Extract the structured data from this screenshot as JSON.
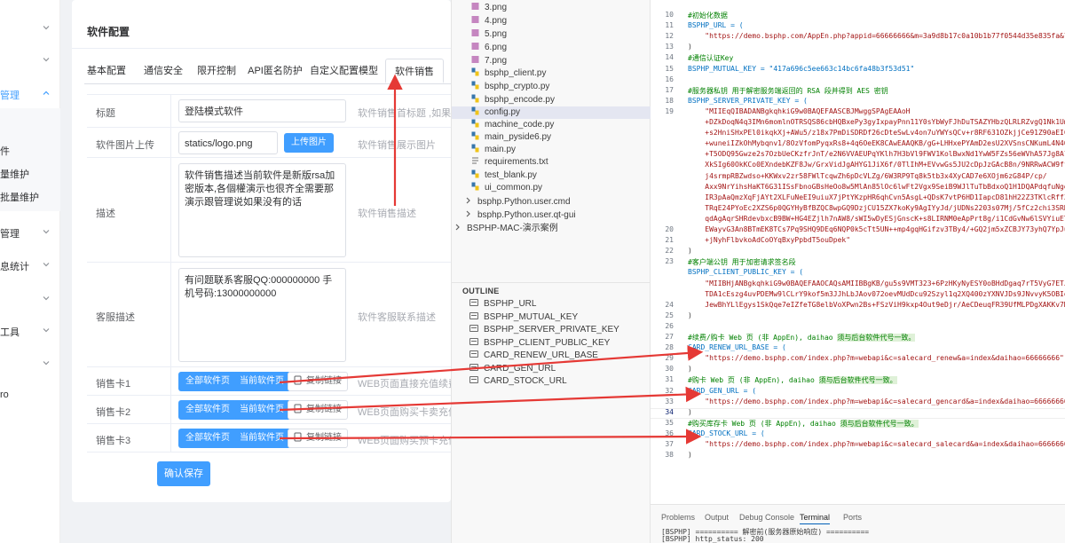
{
  "sidebar": {
    "items": [
      {
        "label": "管理"
      },
      {
        "label": "件"
      },
      {
        "label": "量维护"
      },
      {
        "label": "批量维护"
      },
      {
        "label": "管理"
      },
      {
        "label": "息统计"
      },
      {
        "label": "工具"
      },
      {
        "label": "ro"
      }
    ]
  },
  "panel": {
    "title": "软件配置",
    "tabs": [
      "基本配置",
      "通信安全",
      "限开控制",
      "API匿名防护",
      "自定义配置模型",
      "软件销售"
    ],
    "active_tab": "软件销售",
    "rows": {
      "title": {
        "label": "标题",
        "value": "登陆模式软件",
        "hint": "软件销售首标题 ,如果空着"
      },
      "image": {
        "label": "软件图片上传",
        "value": "statics/logo.png",
        "button": "上传图片",
        "hint": "软件销售展示图片"
      },
      "desc": {
        "label": "描述",
        "value": "软件销售描述当前软件是新版rsa加密版本,各個權演示也很齐全需要那演示跟管理说如果没有的话",
        "hint": "软件销售描述"
      },
      "service": {
        "label": "客服描述",
        "value": "有问题联系客服QQ:000000000 手机号码:13000000000",
        "hint": "软件客服联系描述"
      },
      "cards": [
        {
          "label": "销售卡1",
          "btn_all": "全部软件页",
          "btn_cur": "当前软件页",
          "btn_copy": "复制链接",
          "hint": "WEB页面直接充值续费"
        },
        {
          "label": "销售卡2",
          "btn_all": "全部软件页",
          "btn_cur": "当前软件页",
          "btn_copy": "复制链接",
          "hint": "WEB页面购买卡卖充值"
        },
        {
          "label": "销售卡3",
          "btn_all": "全部软件页",
          "btn_cur": "当前软件页",
          "btn_copy": "复制链接",
          "hint": "WEB页面购买预卡充值"
        }
      ]
    },
    "save_button": "确认保存"
  },
  "explorer": {
    "files": [
      "3.png",
      "4.png",
      "5.png",
      "6.png",
      "7.png",
      "bsphp_client.py",
      "bsphp_crypto.py",
      "bsphp_encode.py",
      "config.py",
      "machine_code.py",
      "main_pyside6.py",
      "main.py",
      "requirements.txt",
      "test_blank.py",
      "ui_common.py",
      "bsphp.Python.user.cmd",
      "bsphp.Python.user.qt-gui",
      "BSPHP-MAC-演示案例"
    ],
    "selected": "config.py",
    "outline_title": "OUTLINE",
    "outline": [
      "BSPHP_URL",
      "BSPHP_MUTUAL_KEY",
      "BSPHP_SERVER_PRIVATE_KEY",
      "BSPHP_CLIENT_PUBLIC_KEY",
      "CARD_RENEW_URL_BASE",
      "CARD_GEN_URL",
      "CARD_STOCK_URL"
    ]
  },
  "editor": {
    "line_numbers": [
      "10",
      "11",
      "12",
      "13",
      "14",
      "15",
      "16",
      "17",
      "18",
      "19",
      "",
      "",
      "",
      "",
      "",
      "",
      "",
      "",
      "",
      "",
      "20",
      "21",
      "22",
      "23",
      "",
      "",
      "",
      "24",
      "25",
      "26",
      "27",
      "28",
      "29",
      "30",
      "31",
      "32",
      "33",
      "34",
      "35",
      "36",
      "37",
      "38"
    ],
    "current_line": "34",
    "lines": {
      "l10": "#初始化数据",
      "l11": "BSPHP_URL = (",
      "l12": "    \"https://demo.bsphp.com/AppEn.php?appid=66666666&m=3a9d8b17c0a10b1b77f0544d35e835fa&lang=0\"",
      "l13": ")",
      "l14": "#通信认证Key",
      "l15": "BSPHP_MUTUAL_KEY = \"417a696c5ee663c14bc6fa48b3f53d51\"",
      "l17": "#服务器私钥 用于解密服务端返回的 RSA 段并得到 AES 密钥",
      "l18": "BSPHP_SERVER_PRIVATE_KEY = (",
      "l19a": "    \"MIIEqQIBADANBgkqhkiG9w0BAQEFAASCBJMwggSPAgEAAoH",
      "l19b": "    +DZkDoqN4q3IMn6momlnOTRSQS86cbHQBxePy3gyIxpayPnn11Y0sYbWyFJhDuTSAZYHbzQLRLRZvgQ1Nk1UmF",
      "l19c": "    +s2HniSHxPEl0ikqkXj+AWu5/z18x7PmDiSDRDf26cDteSwLv4on7uYWYsQCv+r8RF631OZkjjCe91Z90aEIC",
      "l19d": "    +wuneiIZkOhMybqnv1/8OzVfomPyqxRs8+4q6OeEK8CAwEAAQKB/gG+LHHxePYAmD2esU2XVSnsCNKumL4N4O",
      "l19e": "    +T5ODQ95Gwze2s7OzbUeCKzfrJnT/e2N6VVAEUPqYKlh7H3bVl9FWV1KolBwxNd1YwW5FZs56eWVhA57Jg8Al",
      "l19f": "    XkSIg60OkKCo0EXndebKZF8Jw/GrxVidJgAHYG1JiX6f/0TlIhM+EVvwGs5JU2cDpJzGAcB8n/9NRRwACW9ffr",
      "l19g": "    j4srmpRBZwdso+KKWxv2zr58FWlTcqwZh6pDcVLZg/6W3RP9Tq8k5tb3x4XyCAD7e6XOjm6zG84P/cp/",
      "l19h": "    Axx9NrYihsHaKT6G31ISsFbnoGBsHeOo8w5MlAn85lOc6lwFt2Vgx9SeiB9WJlTuTbBdxoQ1H1DQAPdqfuNgdV",
      "l19i": "    IR3pAaQmzXqFjAYt2XLFuNeEI9uiuX7jPtYKzpHR6qhCvn5AsgL+QDsK7vtP6HD1IapcD81hH22Z3TKlcRffZ",
      "l19j": "    TRqE24PYoEc2XZS6p0QGYHyBfBZQC8wpGQ9DzjCU15ZX7koKy9AgIYyJd/jUDNs2203s07Mj/5fCz2chi3SRD",
      "l19k": "    qdAgAqrSHRdevbxcB9BW+HG4EZjlh7nAW8/sWI5wDyESjGnscK+s8LIRNM0eApPrt8g/i1CdGvNw6lSVYiuET4",
      "l19l": "    EWayvG3An8BTmEK8TCs7Pq9SHQ9DEq6NQP0k5cTt5UN++mp4gqHGifzv3TBy4/+GQ2jm5xZCBJY73yhQ7YpJuV",
      "l19m": "    +jNyhFlbvkoAdCoOYqBxyPpbdT5ouDpek\"",
      "l20": ")",
      "l21": "#客户端公钥 用于加密请求签名段",
      "l22": "BSPHP_CLIENT_PUBLIC_KEY = (",
      "l23a": "    \"MIIBHjANBgkqhkiG9w0BAQEFAAOCAQsAMIIBBgKB/gu5s9VMT323+6PzHKyNyESY0oBHdDgaq7rT5VyG7ETJ",
      "l23b": "    TDA1cEszg4uvPDEMw9lCLrY9kof5m3JJhLbJAov072oevMUdDcu92Szyl1q2XQ400zYXNVJDs9JNvvyK5OBIq",
      "l23c": "    JewBhYLlEgys1SkQqe7eIZfeTG8elbVoXPwn2Bs+FSzViH9kxp4Out9eDjr/AeCDeuqFR39UfMLPDgXAKKv7M",
      "l24": ")",
      "l26_pre": "#续费/购卡 Web 页 (非 AppEn), daihao ",
      "l26_hl": "须与后台软件代号一致。",
      "l27": "CARD_RENEW_URL_BASE = (",
      "l28": "    \"https://demo.bsphp.com/index.php?m=webapi&c=salecard_renew&a=index&daihao=66666666\"",
      "l29": ")",
      "l30_pre": "#购卡 Web 页 (非 AppEn), daihao ",
      "l30_hl": "须与后台软件代号一致。",
      "l31": "CARD_GEN_URL = (",
      "l32": "    \"https://demo.bsphp.com/index.php?m=webapi&c=salecard_gencard&a=index&daihao=66666666\"",
      "l33": ")",
      "l34_pre": "#购买库存卡 Web 页 (非 AppEn), daihao ",
      "l34_hl": "须与后台软件代号一致。",
      "l35": "CARD_STOCK_URL = (",
      "l36": "    \"https://demo.bsphp.com/index.php?m=webapi&c=salecard_salecard&a=index&daihao=66666666\"",
      "l37": ")"
    }
  },
  "bottom_panel": {
    "tabs": [
      "Problems",
      "Output",
      "Debug Console",
      "Terminal",
      "Ports"
    ],
    "active_tab": "Terminal",
    "lines": [
      "[BSPHP] ========== 解密前(服务器原始响应) ==========",
      "[BSPHP] http_status: 200"
    ]
  },
  "colors": {
    "primary": "#409eff",
    "annotation_arrow": "#e53935",
    "comment": "#008000",
    "string": "#a31515",
    "identifier": "#0070c1"
  }
}
